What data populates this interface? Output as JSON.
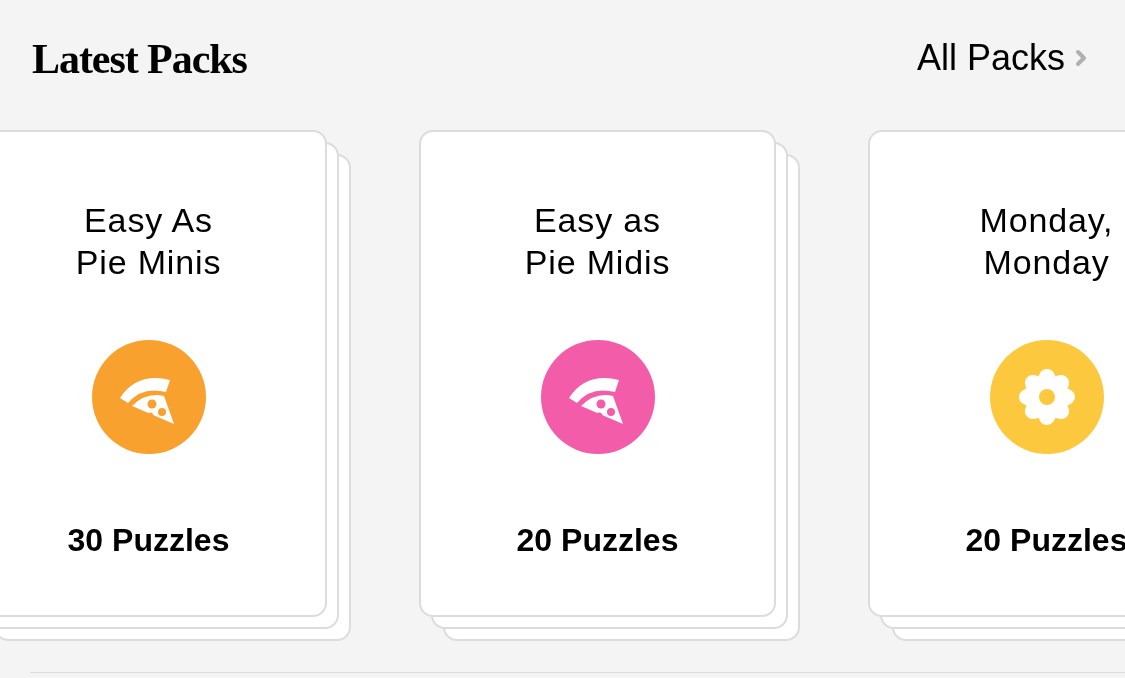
{
  "header": {
    "title": "Latest Packs",
    "all_link": "All Packs"
  },
  "packs": [
    {
      "title_lines": [
        "Easy As",
        "Pie Minis"
      ],
      "kind": "pizza",
      "color": "#f9a12e",
      "count": "30 Puzzles"
    },
    {
      "title_lines": [
        "Easy as",
        "Pie Midis"
      ],
      "kind": "pizza",
      "color": "#f25ca8",
      "count": "20 Puzzles"
    },
    {
      "title_lines": [
        "Monday,",
        "Monday"
      ],
      "kind": "flower",
      "color": "#fcc93e",
      "count": "20 Puzzles"
    }
  ]
}
